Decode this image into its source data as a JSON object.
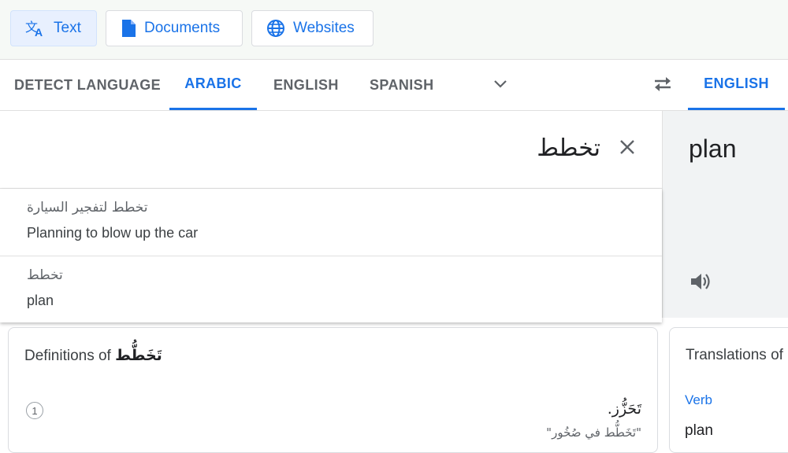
{
  "modes": [
    {
      "label": "Text",
      "icon": "translate-icon",
      "active": true
    },
    {
      "label": "Documents",
      "icon": "document-icon",
      "active": false
    },
    {
      "label": "Websites",
      "icon": "globe-icon",
      "active": false
    }
  ],
  "source_languages": [
    {
      "label": "DETECT LANGUAGE",
      "active": false
    },
    {
      "label": "ARABIC",
      "active": true
    },
    {
      "label": "ENGLISH",
      "active": false
    },
    {
      "label": "SPANISH",
      "active": false
    }
  ],
  "target_languages": [
    {
      "label": "ENGLISH",
      "active": true
    }
  ],
  "icons": {
    "more_languages": "chevron-down-icon",
    "swap": "swap-icon",
    "clear": "close-icon",
    "listen": "speaker-icon"
  },
  "source": {
    "text": "تخطط"
  },
  "target": {
    "text": "plan"
  },
  "suggestions": [
    {
      "arabic": "تخطط لتفجير السيارة",
      "english": "Planning to blow up the car"
    },
    {
      "arabic": "تخطط",
      "english": "plan"
    }
  ],
  "definitions": {
    "heading": "Definitions of",
    "word": "تَخَطُّط",
    "entries": [
      {
        "number": "1",
        "meaning": "تَحَزُّز.",
        "example": "\"تَخَطُّط في صُخُور\""
      }
    ]
  },
  "translations": {
    "heading": "Translations of",
    "part_of_speech": "Verb",
    "word": "plan"
  },
  "colors": {
    "accent": "#1a73e8",
    "active_mode_bg": "#e8f0fe",
    "target_panel_bg": "#f1f3f4"
  }
}
